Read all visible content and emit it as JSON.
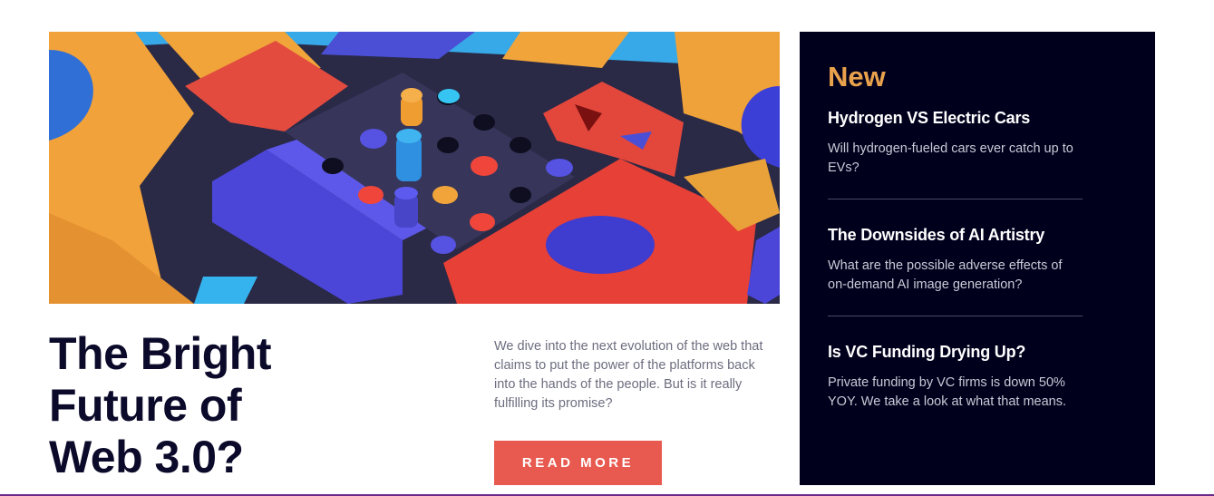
{
  "feature": {
    "headline_lines": [
      "The Bright",
      "Future of",
      "Web 3.0?"
    ],
    "summary": "We dive into the next evolution of the web that claims to put the power of the platforms back into the hands of the people. But is it really fulfilling its promise?",
    "cta_label": "READ MORE"
  },
  "sidebar": {
    "heading": "New",
    "items": [
      {
        "title": "Hydrogen VS Electric Cars",
        "description": "Will hydrogen-fueled cars ever catch up to EVs?"
      },
      {
        "title": "The Downsides of AI Artistry",
        "description": "What are the possible adverse effects of on-demand AI image generation?"
      },
      {
        "title": "Is VC Funding Drying Up?",
        "description": "Private funding by VC firms is down 50% YOY. We take a look at what that means."
      }
    ]
  },
  "colors": {
    "accent_orange": "#e9a24c",
    "button_red": "#e85a4f",
    "panel_navy": "#00001d",
    "headline_navy": "#0b0a2a"
  }
}
